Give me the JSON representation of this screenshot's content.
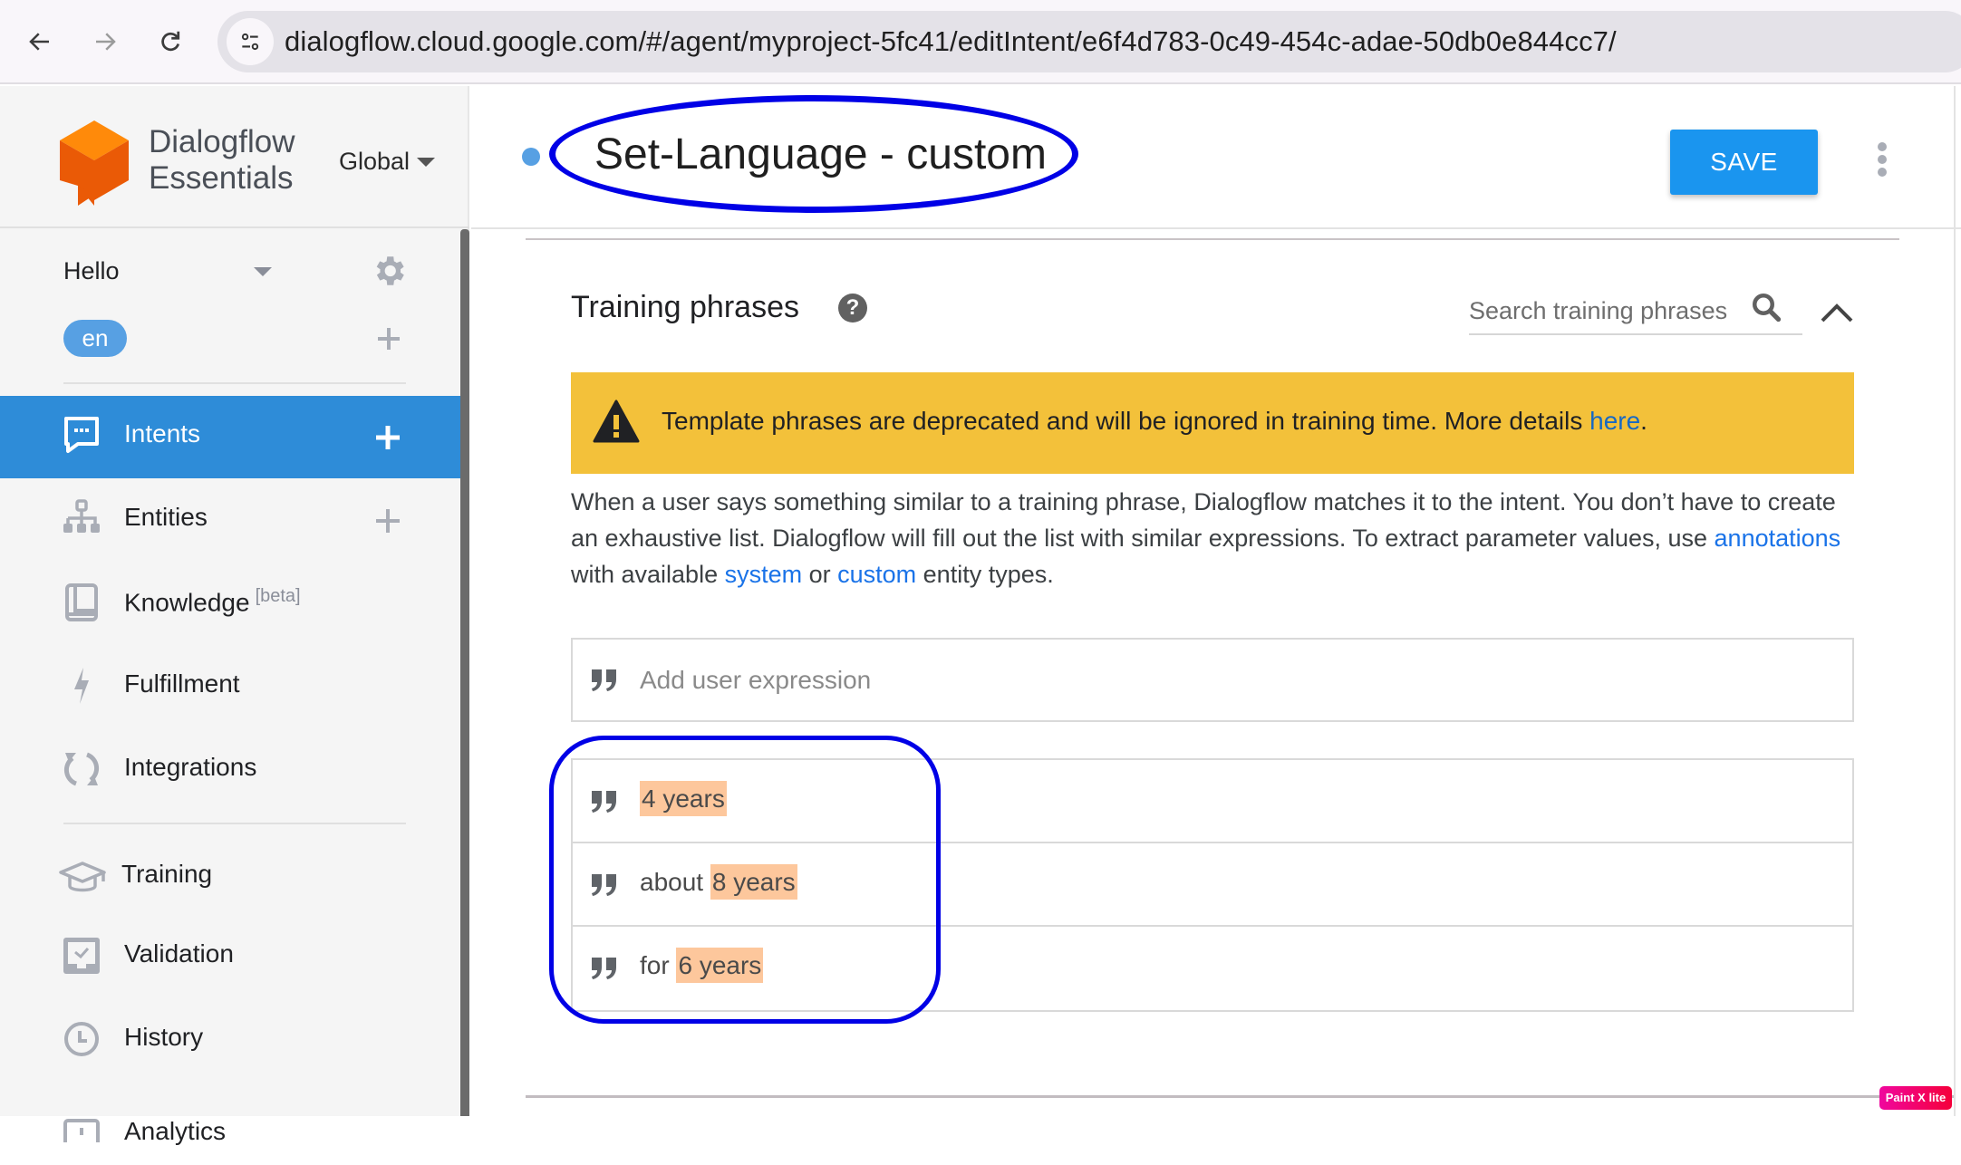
{
  "browser": {
    "back_icon": "arrow-left-icon",
    "forward_icon": "arrow-right-icon",
    "reload_icon": "reload-icon",
    "site_info_icon": "tune-icon",
    "url": "dialogflow.cloud.google.com/#/agent/myproject-5fc41/editIntent/e6f4d783-0c49-454c-adae-50db0e844cc7/"
  },
  "sidebar": {
    "brand_line1": "Dialogflow",
    "brand_line2": "Essentials",
    "region": "Global",
    "agent_name": "Hello",
    "language_chip": "en",
    "items": [
      {
        "label": "Intents",
        "icon": "chat-bubble-icon",
        "active": true,
        "has_add": true
      },
      {
        "label": "Entities",
        "icon": "hierarchy-icon",
        "active": false,
        "has_add": true
      },
      {
        "label": "Knowledge",
        "badge": "[beta]",
        "icon": "book-icon",
        "active": false,
        "has_add": false
      },
      {
        "label": "Fulfillment",
        "icon": "lightning-icon",
        "active": false,
        "has_add": false
      },
      {
        "label": "Integrations",
        "icon": "sync-icon",
        "active": false,
        "has_add": false
      },
      {
        "label": "Training",
        "icon": "graduation-cap-icon",
        "active": false,
        "has_add": false
      },
      {
        "label": "Validation",
        "icon": "validation-inbox-icon",
        "active": false,
        "has_add": false
      },
      {
        "label": "History",
        "icon": "clock-icon",
        "active": false,
        "has_add": false
      },
      {
        "label": "Analytics",
        "icon": "analytics-icon",
        "active": false,
        "has_add": false
      }
    ]
  },
  "header": {
    "intent_title": "Set-Language - custom",
    "save_label": "SAVE"
  },
  "training_phrases": {
    "title": "Training phrases",
    "search_placeholder": "Search training phrases",
    "warning": {
      "text": "Template phrases are deprecated and will be ignored in training time. More details ",
      "link": "here",
      "suffix": "."
    },
    "description": {
      "part1": "When a user says something similar to a training phrase, Dialogflow matches it to the intent. You don’t have to create an exhaustive list. Dialogflow will fill out the list with similar expressions. To extract parameter values, use ",
      "link1": "annotations",
      "part2": " with available ",
      "link2": "system",
      "part3": " or ",
      "link3": "custom",
      "part4": " entity types."
    },
    "add_placeholder": "Add user expression",
    "phrases": [
      {
        "prefix": "",
        "annotated": "4 years"
      },
      {
        "prefix": "about ",
        "annotated": "8 years"
      },
      {
        "prefix": "for ",
        "annotated": "6 years"
      }
    ],
    "annotation_color": "#fdc79c"
  },
  "colors": {
    "accent": "#2e8cd8",
    "save_button": "#1a95ef",
    "warning_bg": "#f3c13a",
    "highlight_outline": "#0000e6"
  },
  "watermark": "Paint X lite"
}
